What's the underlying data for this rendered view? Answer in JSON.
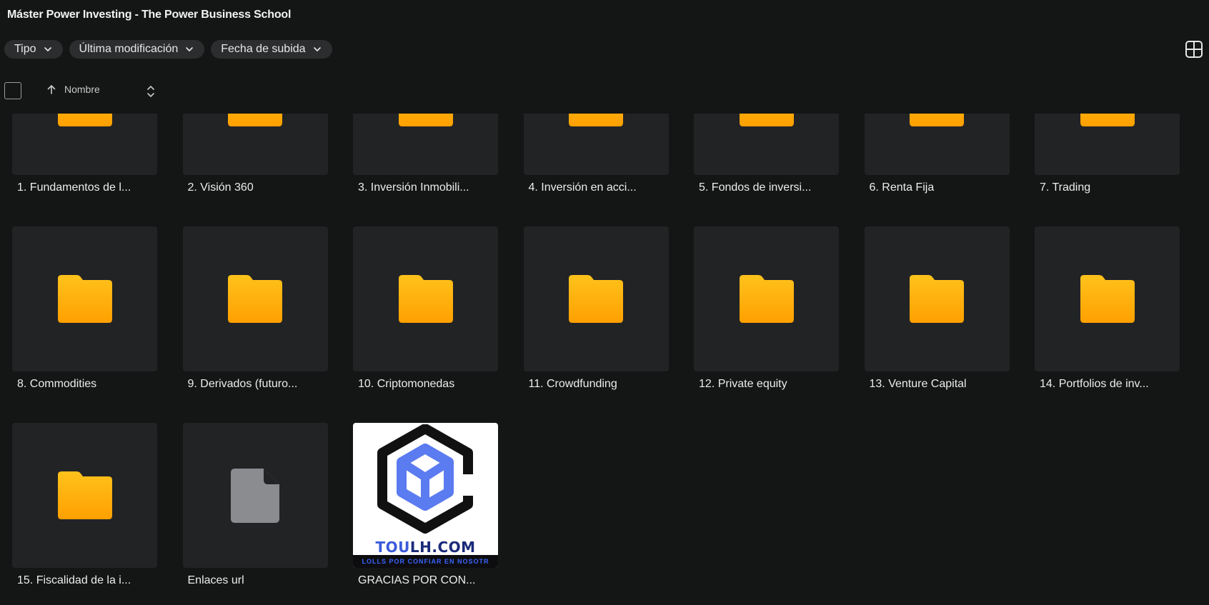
{
  "header": {
    "title": "Máster Power Investing - The Power Business School"
  },
  "filters": [
    {
      "label": "Tipo"
    },
    {
      "label": "Última modificación"
    },
    {
      "label": "Fecha de subida"
    }
  ],
  "sort": {
    "label": "Nombre"
  },
  "items": [
    {
      "name": "1. Fundamentos de l...",
      "type": "folder"
    },
    {
      "name": "2. Visión 360",
      "type": "folder"
    },
    {
      "name": "3. Inversión Inmobili...",
      "type": "folder"
    },
    {
      "name": "4. Inversión en acci...",
      "type": "folder"
    },
    {
      "name": "5. Fondos de inversi...",
      "type": "folder"
    },
    {
      "name": "6. Renta Fija",
      "type": "folder"
    },
    {
      "name": "7. Trading",
      "type": "folder"
    },
    {
      "name": "8. Commodities",
      "type": "folder"
    },
    {
      "name": "9. Derivados (futuro...",
      "type": "folder"
    },
    {
      "name": "10. Criptomonedas",
      "type": "folder"
    },
    {
      "name": "11. Crowdfunding",
      "type": "folder"
    },
    {
      "name": "12. Private equity",
      "type": "folder"
    },
    {
      "name": "13. Venture Capital",
      "type": "folder"
    },
    {
      "name": "14. Portfolios de inv...",
      "type": "folder"
    },
    {
      "name": "15. Fiscalidad de la i...",
      "type": "folder"
    },
    {
      "name": "Enlaces url",
      "type": "file"
    },
    {
      "name": "GRACIAS POR CON...",
      "type": "image"
    }
  ],
  "image_thumb": {
    "brand_part1": "TOU",
    "brand_part2": "LH.COM",
    "stripe_text": "LOLLS POR CONFIAR EN NOSOTR"
  },
  "colors": {
    "background": "#141515",
    "tile": "#222325",
    "chip": "#2c2d2f",
    "folder_top": "#ffc21c",
    "folder_bottom": "#ffa000",
    "file": "#8a8c90"
  }
}
